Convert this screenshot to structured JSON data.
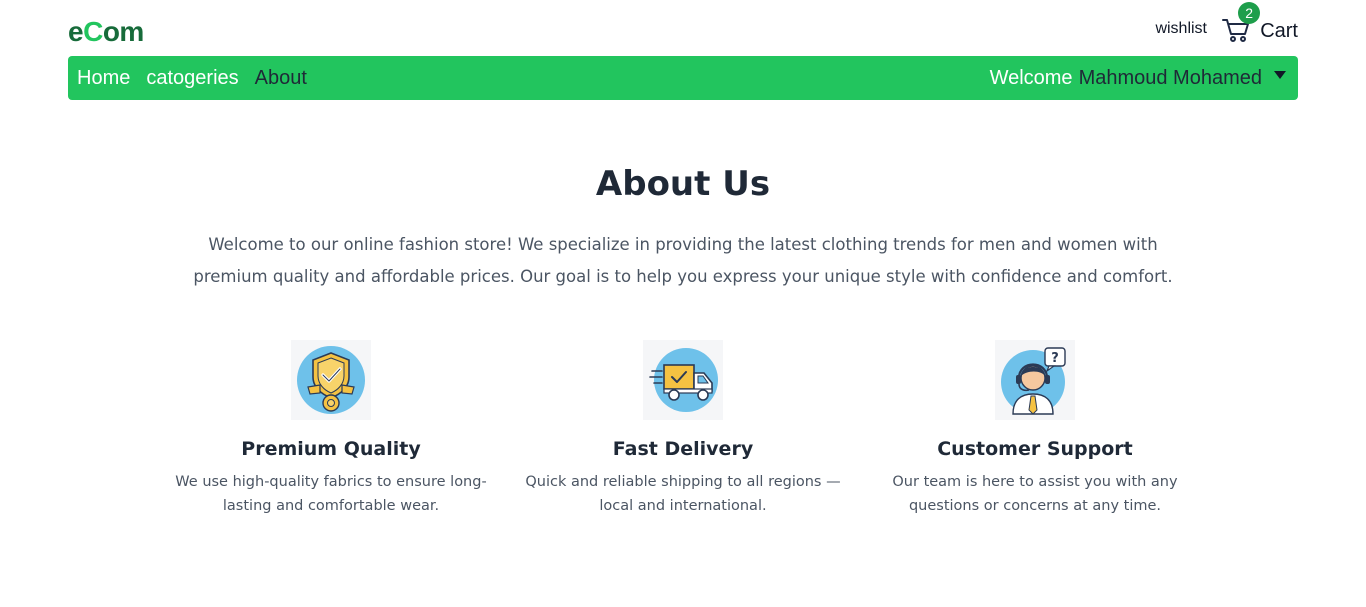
{
  "header": {
    "logo_prefix": "e",
    "logo_accent": "C",
    "logo_suffix": "om",
    "wishlist_label": "wishlist",
    "cart_label": "Cart",
    "cart_count": "2"
  },
  "nav": {
    "home": "Home",
    "categories": "catogeries",
    "about": "About",
    "welcome_word": "Welcome",
    "user_name": "Mahmoud Mohamed"
  },
  "about": {
    "title": "About Us",
    "description": "Welcome to our online fashion store! We specialize in providing the latest clothing trends for men and women with premium quality and affordable prices. Our goal is to help you express your unique style with confidence and comfort."
  },
  "features": [
    {
      "icon": "shield-check-badge-icon",
      "title": "Premium Quality",
      "text": "We use high-quality fabrics to ensure long-lasting and comfortable wear."
    },
    {
      "icon": "delivery-truck-icon",
      "title": "Fast Delivery",
      "text": "Quick and reliable shipping to all regions — local and international."
    },
    {
      "icon": "customer-support-agent-icon",
      "title": "Customer Support",
      "text": "Our team is here to assist you with any questions or concerns at any time."
    }
  ],
  "colors": {
    "brand_green": "#22c55e",
    "logo_dark_green": "#176b3a",
    "badge_green": "#1e9e4b",
    "icon_blue": "#6ec1ea",
    "icon_yellow": "#f5c242"
  }
}
